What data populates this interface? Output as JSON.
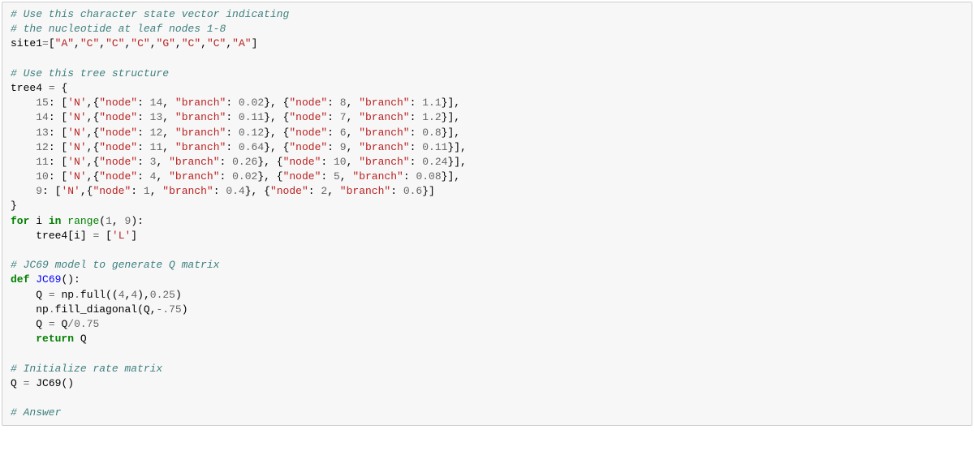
{
  "code": {
    "comment1": "# Use this character state vector indicating",
    "comment2": "# the nucleotide at leaf nodes 1-8",
    "site_var": "site1",
    "site_vals": [
      "\"A\"",
      "\"C\"",
      "\"C\"",
      "\"C\"",
      "\"G\"",
      "\"C\"",
      "\"C\"",
      "\"A\""
    ],
    "comment3": "# Use this tree structure",
    "tree_var": "tree4",
    "tree_lines": {
      "k15": "15",
      "k14": "14",
      "k13": "13",
      "k12": "12",
      "k11": "11",
      "k10": "10",
      "k9": "9"
    },
    "node_key": "\"node\"",
    "branch_key": "\"branch\"",
    "n_str": "'N'",
    "l_str": "'L'",
    "vals": {
      "l15": {
        "n1": "14",
        "b1": "0.02",
        "n2": "8",
        "b2": "1.1"
      },
      "l14": {
        "n1": "13",
        "b1": "0.11",
        "n2": "7",
        "b2": "1.2"
      },
      "l13": {
        "n1": "12",
        "b1": "0.12",
        "n2": "6",
        "b2": "0.8"
      },
      "l12": {
        "n1": "11",
        "b1": "0.64",
        "n2": "9",
        "b2": "0.11"
      },
      "l11": {
        "n1": "3",
        "b1": "0.26",
        "n2": "10",
        "b2": "0.24"
      },
      "l10": {
        "n1": "4",
        "b1": "0.02",
        "n2": "5",
        "b2": "0.08"
      },
      "l9": {
        "n1": "1",
        "b1": "0.4",
        "n2": "2",
        "b2": "0.6"
      }
    },
    "for_kw": "for",
    "in_kw": "in",
    "range_fn": "range",
    "range_args": {
      "a": "1",
      "b": "9"
    },
    "loop_var": "i",
    "comment4": "# JC69 model to generate Q matrix",
    "def_kw": "def",
    "func_name": "JC69",
    "q_var": "Q",
    "np": "np",
    "full_fn": "full",
    "full_args": {
      "shape_a": "4",
      "shape_b": "4",
      "val": "0.25"
    },
    "fill_diag_fn": "fill_diagonal",
    "fill_val": ".75",
    "divisor": "0.75",
    "return_kw": "return",
    "comment5": "# Initialize rate matrix",
    "comment6": "# Answer"
  }
}
